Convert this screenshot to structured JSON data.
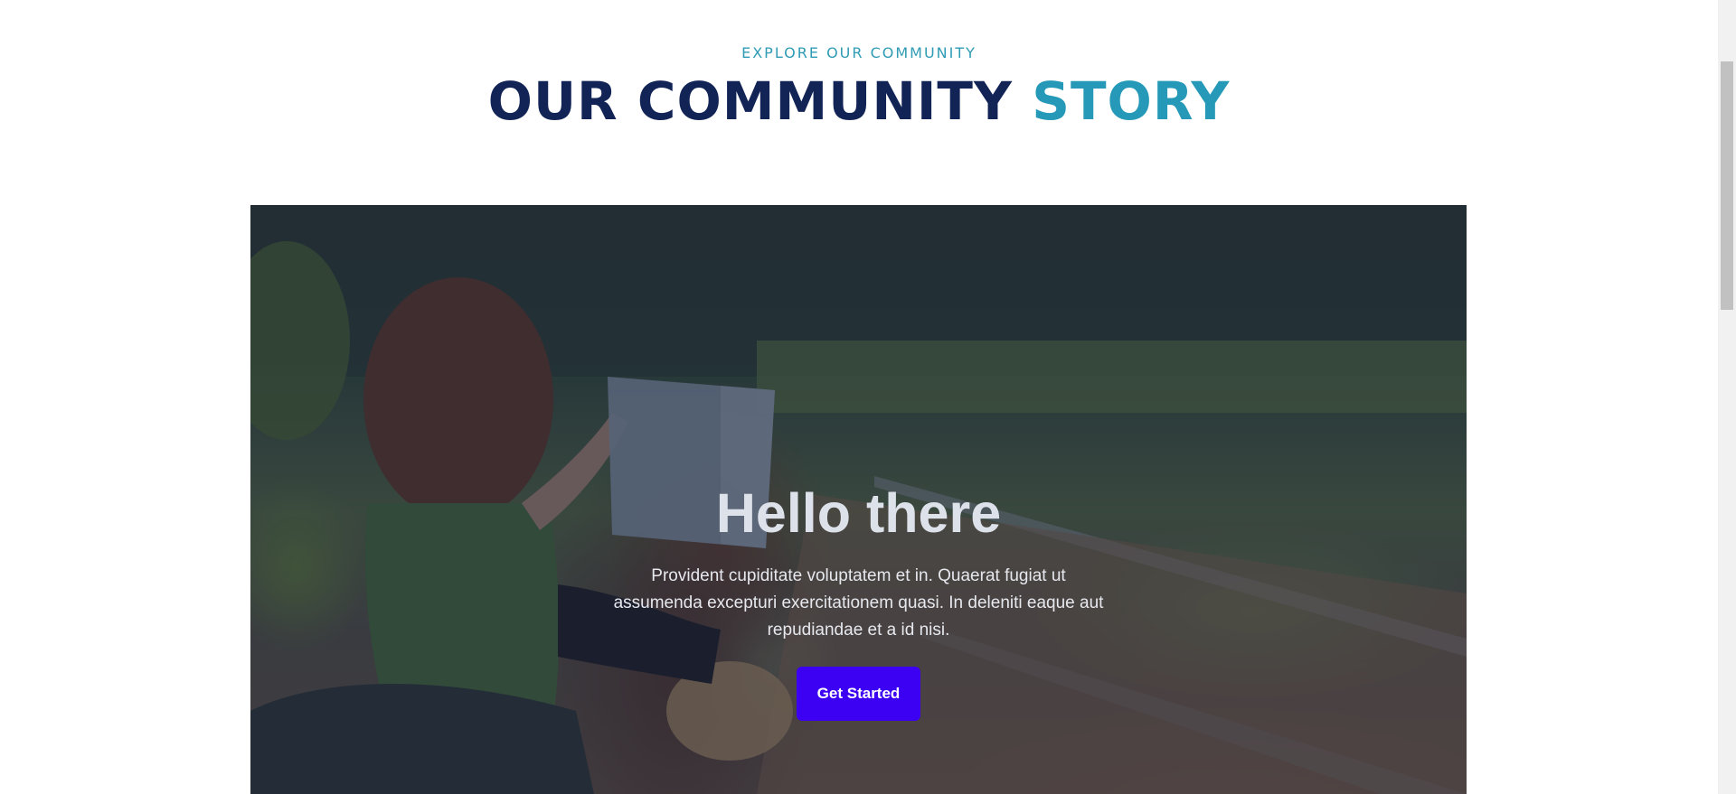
{
  "section": {
    "eyebrow": "EXPLORE OUR COMMUNITY",
    "title_main": "OUR COMMUNITY",
    "title_accent": "STORY"
  },
  "hero": {
    "heading": "Hello there",
    "paragraph": "Provident cupiditate voluptatem et in. Quaerat fugiat ut assumenda excepturi exercitationem quasi. In deleniti eaque aut repudiandae et a id nisi.",
    "button_label": "Get Started",
    "button_color": "#3c00f3",
    "image_description": "woman-reading-map-by-railway"
  },
  "colors": {
    "title_dark": "#122456",
    "title_accent": "#2599b7",
    "eyebrow": "#2f9bb4"
  }
}
